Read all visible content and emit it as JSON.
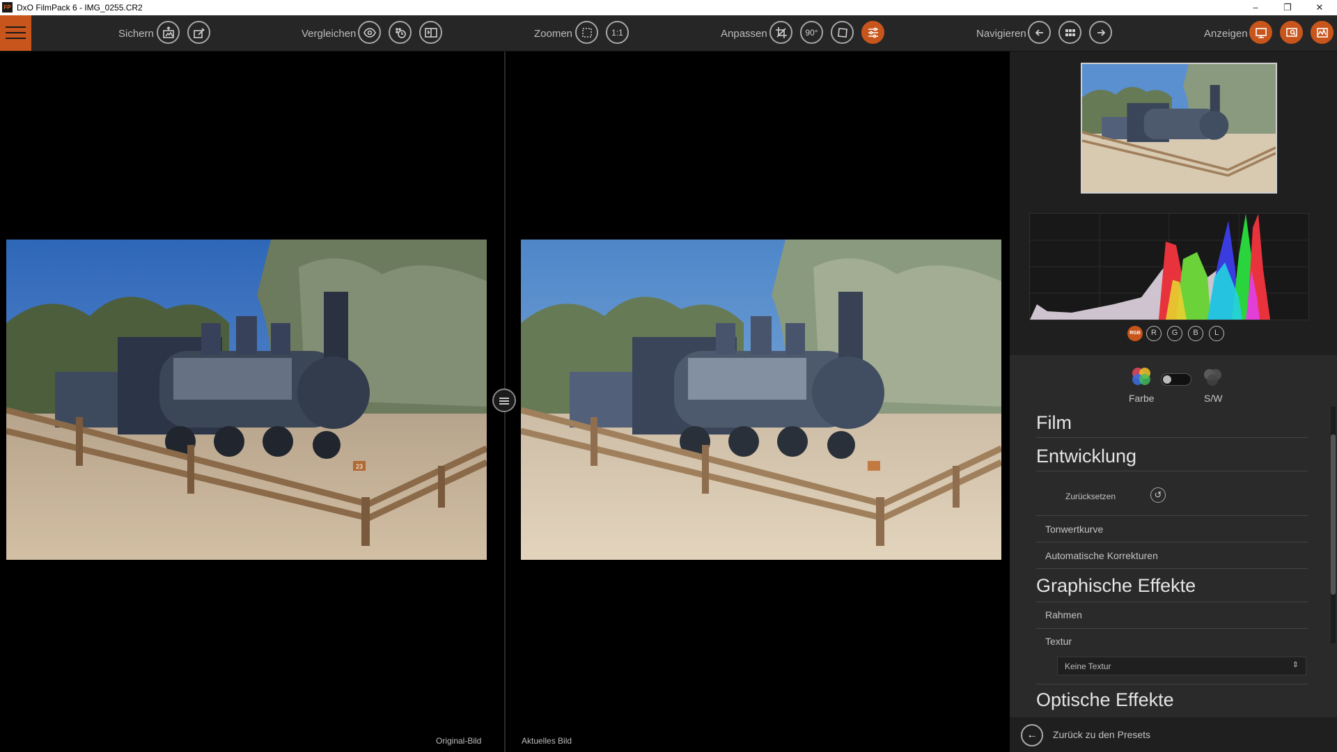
{
  "window": {
    "app_icon": "FP",
    "title": "DxO FilmPack 6 - IMG_0255.CR2",
    "controls": {
      "minimize": "–",
      "maximize": "❐",
      "close": "✕"
    }
  },
  "toolbar": {
    "groups": {
      "save": "Sichern",
      "compare": "Vergleichen",
      "zoom": "Zoomen",
      "adjust": "Anpassen",
      "navigate": "Navigieren",
      "display": "Anzeigen"
    },
    "zoom_one_to_one": "1:1",
    "rotate_label": "90°"
  },
  "viewer": {
    "left_caption": "Original-Bild",
    "right_caption": "Aktuelles Bild",
    "locomotive_number": "23"
  },
  "histogram": {
    "channels": [
      "RGB",
      "R",
      "G",
      "B",
      "L"
    ],
    "active_channel": "RGB"
  },
  "mode": {
    "color": "Farbe",
    "bw": "S/W",
    "selected": "Farbe"
  },
  "sections": {
    "film": "Film",
    "development": "Entwicklung",
    "reset": "Zurücksetzen",
    "tone_curve": "Tonwertkurve",
    "auto_corrections": "Automatische Korrekturen",
    "graphic_effects": "Graphische Effekte",
    "frames": "Rahmen",
    "texture": "Textur",
    "texture_value": "Keine Textur",
    "optical_effects": "Optische Effekte"
  },
  "footer": {
    "back_label": "Zurück zu den Presets"
  },
  "colors": {
    "accent": "#c8551b",
    "toolbar_bg": "#262626",
    "panel_bg": "#2a2a2a"
  }
}
